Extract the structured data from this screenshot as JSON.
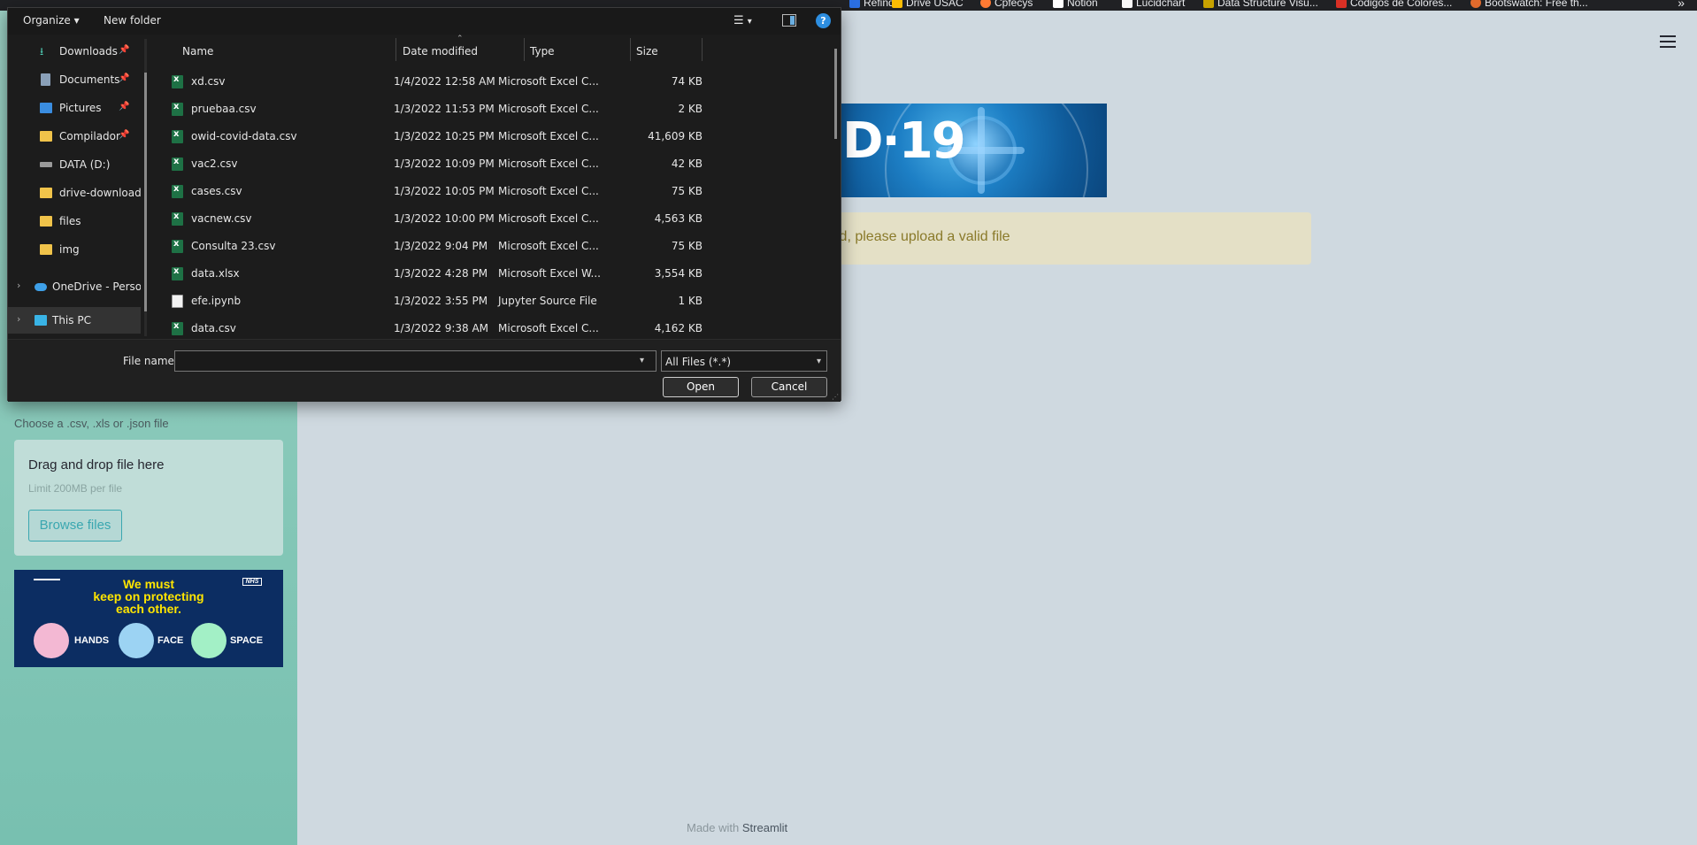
{
  "bookmarks": [
    {
      "label": "Refind",
      "icon": "refind-icon",
      "color": "#2b6fe3"
    },
    {
      "label": "Drive USAC",
      "icon": "drive-icon",
      "color": "#fbbc04"
    },
    {
      "label": "Cpfecys",
      "icon": "cpfecys-icon",
      "color": "#ff7a33"
    },
    {
      "label": "Notion",
      "icon": "notion-icon",
      "color": "#ffffff"
    },
    {
      "label": "Lucidchart",
      "icon": "lucidchart-icon",
      "color": "#f9f9f9"
    },
    {
      "label": "Data Structure Visu...",
      "icon": "usf-icon",
      "color": "#c8a200"
    },
    {
      "label": "Códigos de Colores...",
      "icon": "codigos-icon",
      "color": "#d93025"
    },
    {
      "label": "Bootswatch: Free th...",
      "icon": "bootswatch-icon",
      "color": "#e06a2c"
    }
  ],
  "app": {
    "banner_text": "D·19",
    "alert_text": "id, please upload a valid file",
    "upload_label": "Choose a .csv, .xls or .json file",
    "dropzone_title": "Drag and drop file here",
    "dropzone_limit": "Limit 200MB per file",
    "browse_label": "Browse files",
    "footer_prefix": "Made with",
    "footer_brand": "Streamlit",
    "nhs_line1": "We must",
    "nhs_line2": "keep on protecting",
    "nhs_line3": "each other.",
    "nhs_hands": "HANDS",
    "nhs_face": "FACE",
    "nhs_space": "SPACE",
    "nhs_logo": "NHS"
  },
  "dialog": {
    "organize_label": "Organize",
    "new_folder_label": "New folder",
    "help_glyph": "?",
    "nav": [
      {
        "label": "Downloads",
        "icon": "downloads-icon",
        "pinned": true
      },
      {
        "label": "Documents",
        "icon": "documents-icon",
        "pinned": true
      },
      {
        "label": "Pictures",
        "icon": "pictures-icon",
        "pinned": true
      },
      {
        "label": "Compilador",
        "icon": "folder-icon",
        "pinned": true
      },
      {
        "label": "DATA (D:)",
        "icon": "drive-icon",
        "pinned": false
      },
      {
        "label": "drive-download",
        "icon": "folder-icon",
        "pinned": false
      },
      {
        "label": "files",
        "icon": "folder-icon",
        "pinned": false
      },
      {
        "label": "img",
        "icon": "folder-icon",
        "pinned": false
      },
      {
        "label": "OneDrive - Perso",
        "icon": "onedrive-icon",
        "pinned": false
      },
      {
        "label": "This PC",
        "icon": "this-pc-icon",
        "pinned": false
      }
    ],
    "columns": {
      "name": "Name",
      "date": "Date modified",
      "type": "Type",
      "size": "Size"
    },
    "files": [
      {
        "name": "xd.csv",
        "date": "1/4/2022 12:58 AM",
        "type": "Microsoft Excel C...",
        "size": "74 KB",
        "kind": "xls"
      },
      {
        "name": "pruebaa.csv",
        "date": "1/3/2022 11:53 PM",
        "type": "Microsoft Excel C...",
        "size": "2 KB",
        "kind": "xls"
      },
      {
        "name": "owid-covid-data.csv",
        "date": "1/3/2022 10:25 PM",
        "type": "Microsoft Excel C...",
        "size": "41,609 KB",
        "kind": "xls"
      },
      {
        "name": "vac2.csv",
        "date": "1/3/2022 10:09 PM",
        "type": "Microsoft Excel C...",
        "size": "42 KB",
        "kind": "xls"
      },
      {
        "name": "cases.csv",
        "date": "1/3/2022 10:05 PM",
        "type": "Microsoft Excel C...",
        "size": "75 KB",
        "kind": "xls"
      },
      {
        "name": "vacnew.csv",
        "date": "1/3/2022 10:00 PM",
        "type": "Microsoft Excel C...",
        "size": "4,563 KB",
        "kind": "xls"
      },
      {
        "name": "Consulta 23.csv",
        "date": "1/3/2022 9:04 PM",
        "type": "Microsoft Excel C...",
        "size": "75 KB",
        "kind": "xls"
      },
      {
        "name": "data.xlsx",
        "date": "1/3/2022 4:28 PM",
        "type": "Microsoft Excel W...",
        "size": "3,554 KB",
        "kind": "xls"
      },
      {
        "name": "efe.ipynb",
        "date": "1/3/2022 3:55 PM",
        "type": "Jupyter Source File",
        "size": "1 KB",
        "kind": "doc"
      },
      {
        "name": "data.csv",
        "date": "1/3/2022 9:38 AM",
        "type": "Microsoft Excel C...",
        "size": "4,162 KB",
        "kind": "xls"
      }
    ],
    "file_name_label": "File name:",
    "file_name_value": "",
    "file_type_value": "All Files (*.*)",
    "open_label": "Open",
    "cancel_label": "Cancel"
  }
}
